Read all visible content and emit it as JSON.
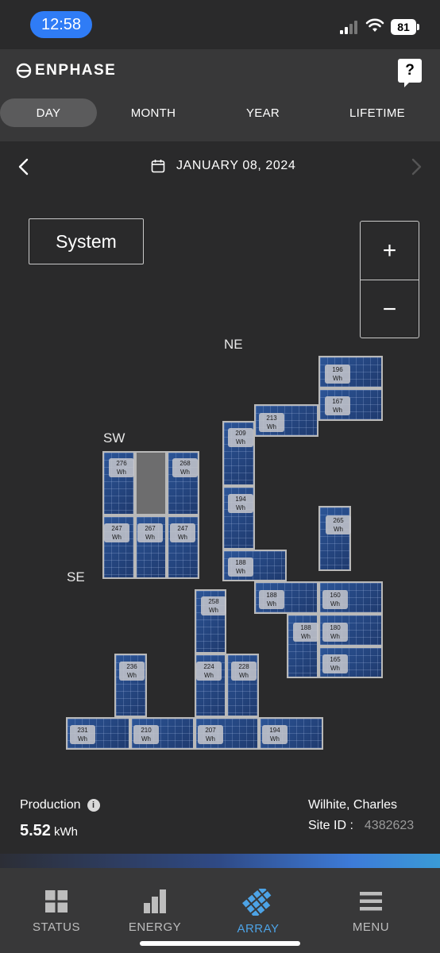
{
  "status_bar": {
    "time": "12:58",
    "battery": "81"
  },
  "header": {
    "brand": "ENPHASE",
    "help_label": "?",
    "tabs": [
      {
        "label": "DAY",
        "active": true
      },
      {
        "label": "MONTH",
        "active": false
      },
      {
        "label": "YEAR",
        "active": false
      },
      {
        "label": "LIFETIME",
        "active": false
      }
    ]
  },
  "date_nav": {
    "date": "JANUARY 08, 2024"
  },
  "array": {
    "system_label": "System",
    "zoom_in": "+",
    "zoom_out": "−",
    "orientations": {
      "ne": "NE",
      "sw": "SW",
      "se": "SE"
    },
    "unit": "Wh",
    "panels": [
      {
        "value": "196"
      },
      {
        "value": "167"
      },
      {
        "value": "213"
      },
      {
        "value": "209"
      },
      {
        "value": "276"
      },
      {
        "value": ""
      },
      {
        "value": "268"
      },
      {
        "value": "247"
      },
      {
        "value": "267"
      },
      {
        "value": "247"
      },
      {
        "value": "194"
      },
      {
        "value": "265"
      },
      {
        "value": "188"
      },
      {
        "value": "188"
      },
      {
        "value": "160"
      },
      {
        "value": "258"
      },
      {
        "value": "188"
      },
      {
        "value": "180"
      },
      {
        "value": "165"
      },
      {
        "value": "236"
      },
      {
        "value": "224"
      },
      {
        "value": "228"
      },
      {
        "value": "231"
      },
      {
        "value": "210"
      },
      {
        "value": "207"
      },
      {
        "value": "194"
      }
    ]
  },
  "production": {
    "title": "Production",
    "value": "5.52",
    "unit": "kWh"
  },
  "site": {
    "owner": "Wilhite, Charles",
    "id_label": "Site ID :",
    "id": "4382623"
  },
  "bottom_nav": [
    {
      "label": "STATUS",
      "icon": "grid-icon",
      "active": false
    },
    {
      "label": "ENERGY",
      "icon": "bars-icon",
      "active": false
    },
    {
      "label": "ARRAY",
      "icon": "array-icon",
      "active": true
    },
    {
      "label": "MENU",
      "icon": "hamburger-icon",
      "active": false
    }
  ],
  "colors": {
    "accent": "#4da3e6",
    "time_pill": "#2f7cf6",
    "panel": "#25467f"
  }
}
